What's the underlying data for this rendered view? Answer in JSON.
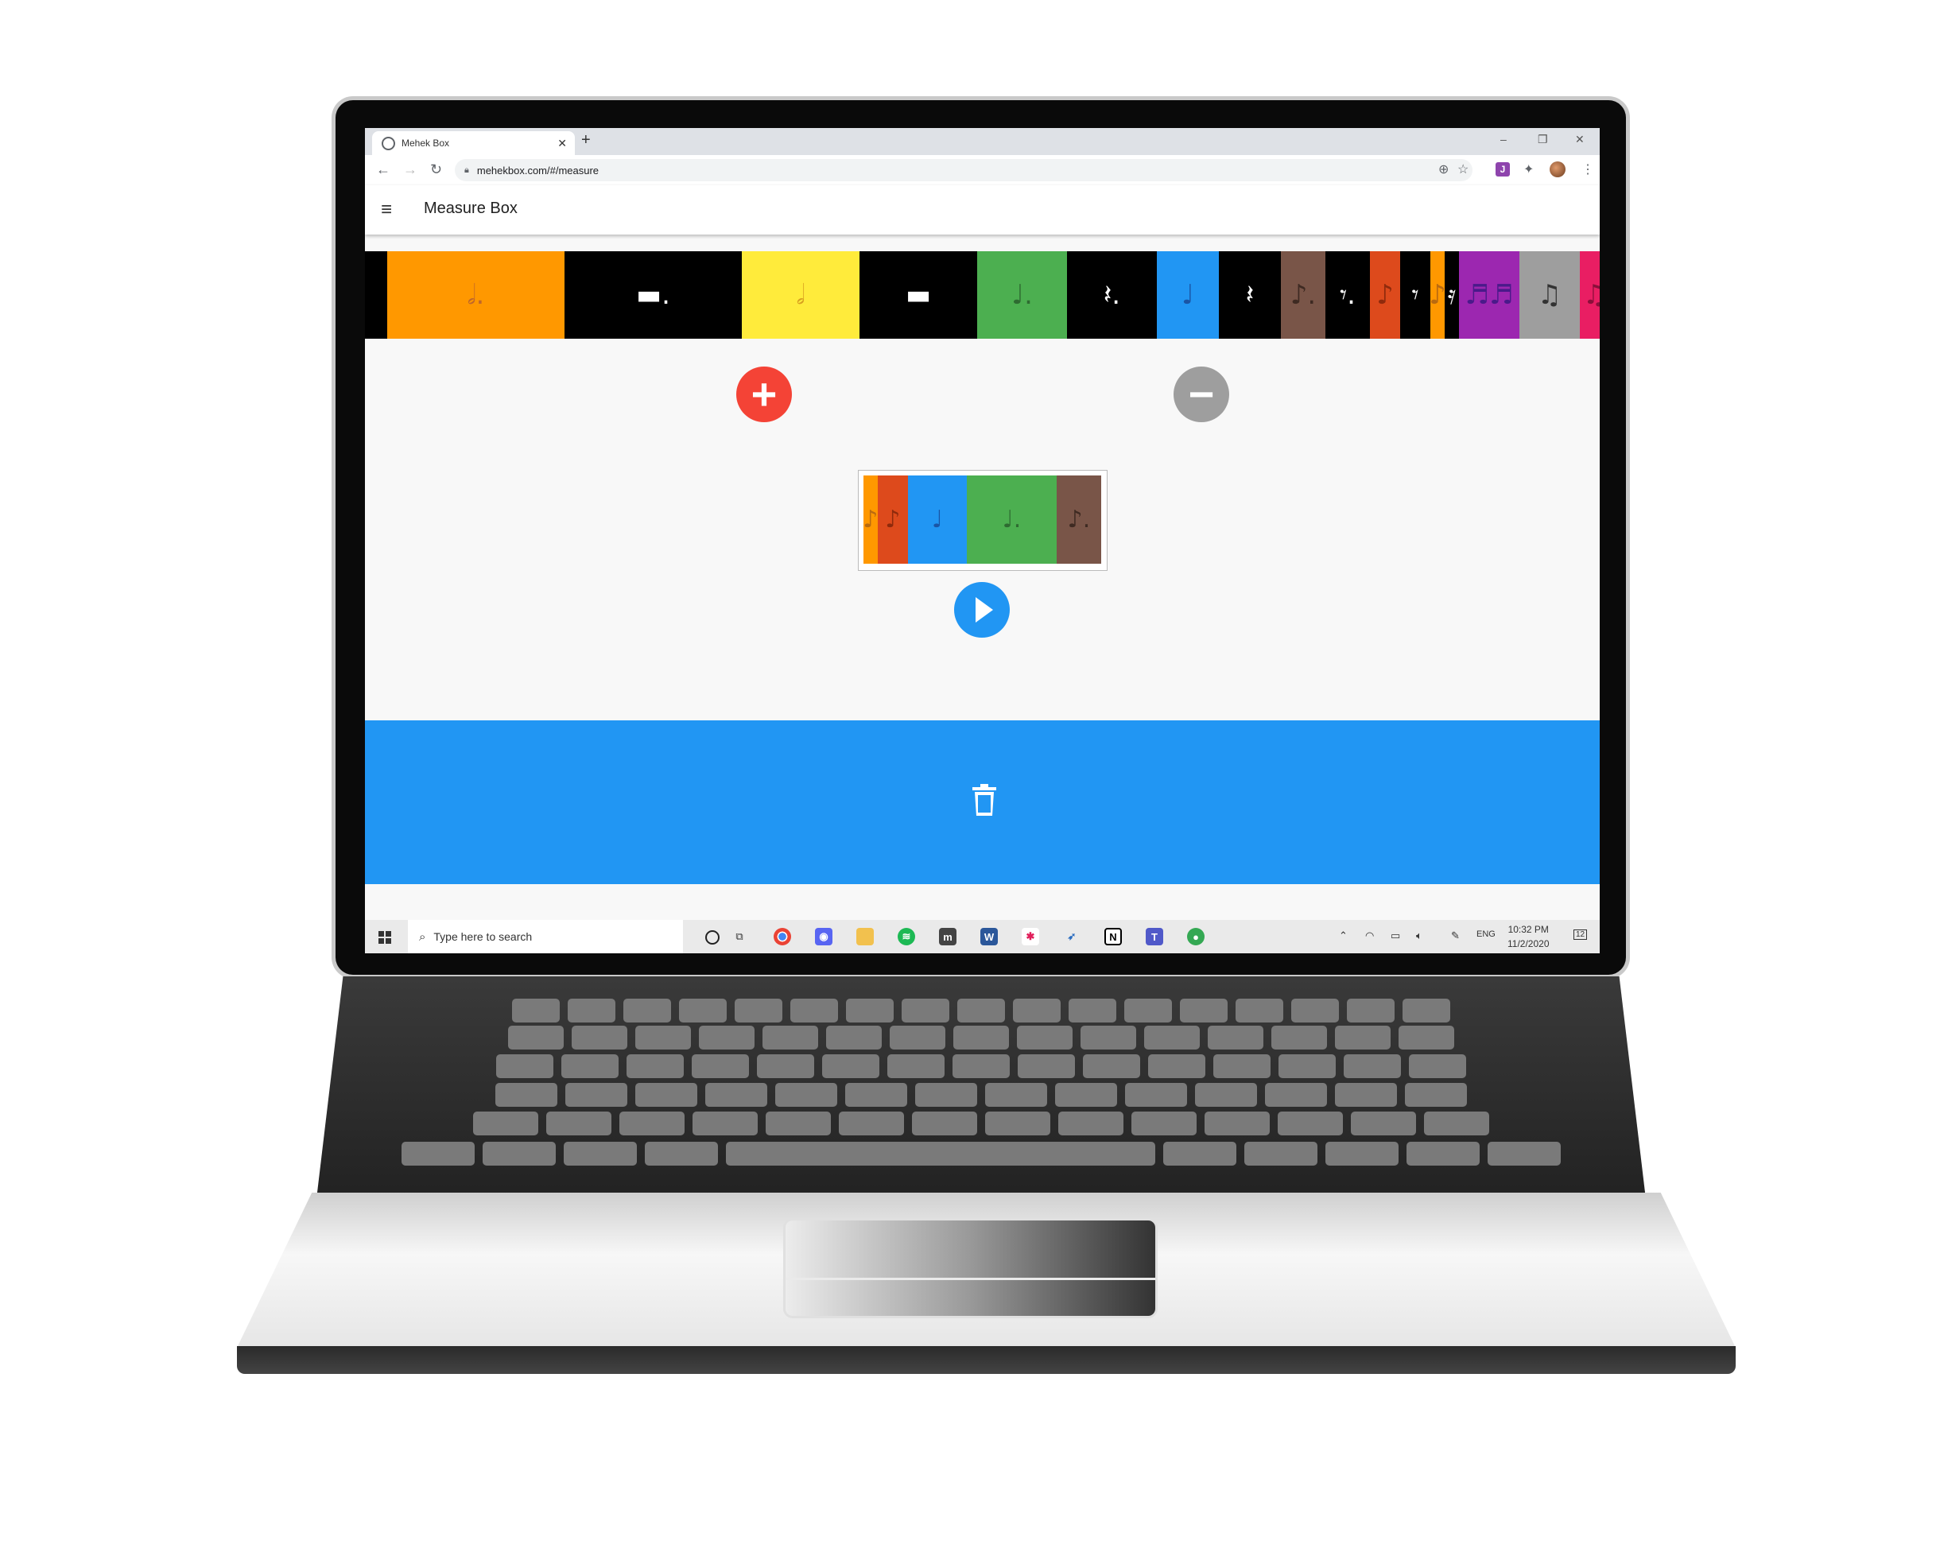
{
  "browser": {
    "tab_title": "Mehek Box",
    "new_tab": "+",
    "url": "mehekbox.com/#/measure",
    "minimize": "–",
    "restore": "❐",
    "close": "✕"
  },
  "app": {
    "menu_icon": "≡",
    "title": "Measure Box",
    "add_symbol": "+",
    "remove_symbol": "−"
  },
  "palette": [
    {
      "name": "dotted-half-note",
      "glyph": "𝅗𝅥.",
      "color": "#ff9800",
      "fg": "#c0672a"
    },
    {
      "name": "dotted-half-rest",
      "glyph": "▬.",
      "color": "#000000",
      "fg": "#ffffff"
    },
    {
      "name": "half-note",
      "glyph": "𝅗𝅥",
      "color": "#ffeb3b",
      "fg": "#d8a020"
    },
    {
      "name": "half-rest",
      "glyph": "▬",
      "color": "#000000",
      "fg": "#ffffff"
    },
    {
      "name": "dotted-quarter-note",
      "glyph": "♩.",
      "color": "#4caf50",
      "fg": "#2e6b31"
    },
    {
      "name": "dotted-quarter-rest",
      "glyph": "𝄽.",
      "color": "#000000",
      "fg": "#ffffff"
    },
    {
      "name": "quarter-note",
      "glyph": "♩",
      "color": "#2196f3",
      "fg": "#1a55a5"
    },
    {
      "name": "quarter-rest",
      "glyph": "𝄽",
      "color": "#000000",
      "fg": "#ffffff"
    },
    {
      "name": "dotted-eighth-note",
      "glyph": "♪.",
      "color": "#795548",
      "fg": "#3e2a22"
    },
    {
      "name": "dotted-eighth-rest",
      "glyph": "𝄾.",
      "color": "#000000",
      "fg": "#ffffff"
    },
    {
      "name": "eighth-note",
      "glyph": "♪",
      "color": "#dd4a1c",
      "fg": "#8f2a0c"
    },
    {
      "name": "eighth-rest",
      "glyph": "𝄾",
      "color": "#000000",
      "fg": "#ffffff"
    },
    {
      "name": "sixteenth-note",
      "glyph": "♪",
      "color": "#ff9800",
      "fg": "#b96a10"
    },
    {
      "name": "sixteenth-rest",
      "glyph": "𝄿",
      "color": "#000000",
      "fg": "#ffffff"
    },
    {
      "name": "four-sixteenths",
      "glyph": "♬♬",
      "color": "#9c27b0",
      "fg": "#4a1a8a"
    },
    {
      "name": "two-eighths",
      "glyph": "♫",
      "color": "#9e9e9e",
      "fg": "#333333"
    },
    {
      "name": "eighth-sixteenth",
      "glyph": "♫",
      "color": "#e91e63",
      "fg": "#8a0f3a"
    }
  ],
  "measure": [
    {
      "name": "sixteenth-note",
      "glyph": "♪",
      "color": "#ff9800",
      "fg": "#b96a10"
    },
    {
      "name": "eighth-note",
      "glyph": "♪",
      "color": "#dd4a1c",
      "fg": "#8f2a0c"
    },
    {
      "name": "quarter-note",
      "glyph": "♩",
      "color": "#2196f3",
      "fg": "#1a55a5"
    },
    {
      "name": "dotted-quarter-note",
      "glyph": "♩.",
      "color": "#4caf50",
      "fg": "#2e6b31"
    },
    {
      "name": "dotted-eighth-note",
      "glyph": "♪.",
      "color": "#795548",
      "fg": "#3e2a22"
    }
  ],
  "taskbar": {
    "search_placeholder": "Type here to search",
    "language": "ENG",
    "time": "10:32 PM",
    "date": "11/2/2020",
    "notifications": "12",
    "icons": [
      "cortana-icon",
      "task-view-icon",
      "chrome-icon",
      "discord-icon",
      "file-explorer-icon",
      "spotify-icon",
      "app-m-icon",
      "word-icon",
      "slack-icon",
      "rocket-icon",
      "notion-icon",
      "teams-icon",
      "maps-icon"
    ]
  }
}
